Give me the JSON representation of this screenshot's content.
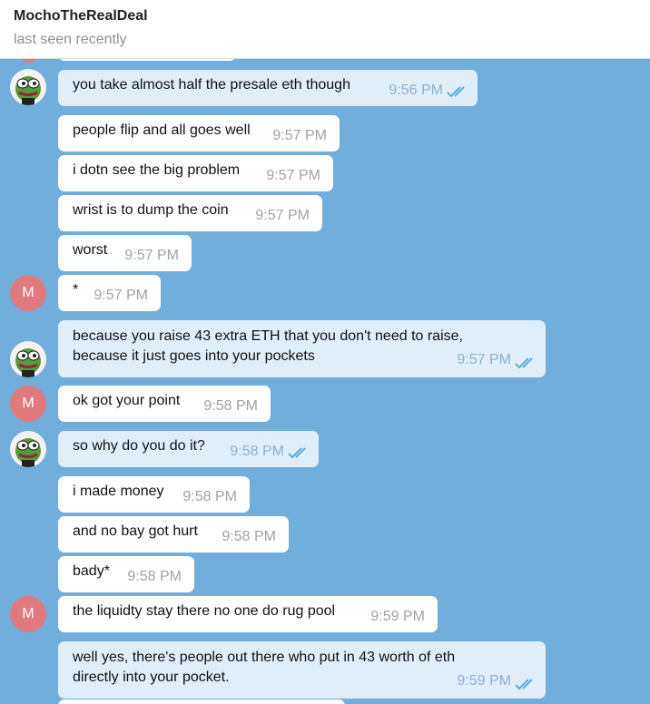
{
  "header": {
    "name": "MochoTheRealDeal",
    "status": "last seen recently"
  },
  "messages": [
    {
      "text": "you take almost half the presale eth though",
      "time": "9:56 PM"
    },
    {
      "text": "people flip and all goes well",
      "time": "9:57 PM"
    },
    {
      "text": "i dotn see the big problem",
      "time": "9:57 PM"
    },
    {
      "text": "wrist is to dump the coin",
      "time": "9:57 PM"
    },
    {
      "text": "worst",
      "time": "9:57 PM"
    },
    {
      "text": "*",
      "time": "9:57 PM"
    },
    {
      "line1": "because you raise 43 extra ETH that you don't need to raise,",
      "line2": "because it just goes into your pockets",
      "time": "9:57 PM"
    },
    {
      "text": "ok got your point",
      "time": "9:58 PM"
    },
    {
      "text": "so why do you do it?",
      "time": "9:58 PM"
    },
    {
      "text": "i made money",
      "time": "9:58 PM"
    },
    {
      "text": "and no bay got hurt",
      "time": "9:58 PM"
    },
    {
      "text": "bady*",
      "time": "9:58 PM"
    },
    {
      "text": "the liquidty stay there no one do rug pool",
      "time": "9:59 PM"
    },
    {
      "line1": "well yes, there's people out there who put in 43 worth of eth",
      "line2": "directly into your pocket.",
      "time": "9:59 PM"
    }
  ],
  "avatar_initial": "M",
  "colors": {
    "chat_bg": "#72aedc",
    "outgoing": "#e0eefa",
    "incoming": "#ffffff",
    "read_check": "#4aa3df",
    "avatar_m": "#e07a7e"
  }
}
